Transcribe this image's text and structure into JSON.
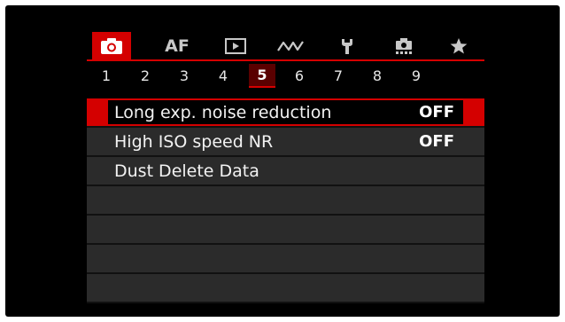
{
  "tabs": [
    {
      "id": "shooting",
      "icon": "camera-icon",
      "active": true
    },
    {
      "id": "af",
      "label": "AF",
      "active": false
    },
    {
      "id": "playback",
      "icon": "playback-icon",
      "active": false
    },
    {
      "id": "wireless",
      "icon": "wireless-icon",
      "active": false
    },
    {
      "id": "setup",
      "icon": "wrench-icon",
      "active": false
    },
    {
      "id": "custom",
      "icon": "custom-functions-icon",
      "active": false
    },
    {
      "id": "mymenu",
      "icon": "star-icon",
      "active": false
    }
  ],
  "pages": [
    "1",
    "2",
    "3",
    "4",
    "5",
    "6",
    "7",
    "8",
    "9"
  ],
  "active_page": "5",
  "items": [
    {
      "label": "Long exp. noise reduction",
      "value": "OFF",
      "selected": true
    },
    {
      "label": "High ISO speed NR",
      "value": "OFF",
      "selected": false
    },
    {
      "label": "Dust Delete Data",
      "value": "",
      "selected": false
    },
    {
      "label": "",
      "value": "",
      "selected": false
    },
    {
      "label": "",
      "value": "",
      "selected": false
    },
    {
      "label": "",
      "value": "",
      "selected": false
    },
    {
      "label": "",
      "value": "",
      "selected": false
    }
  ],
  "colors": {
    "accent": "#d40000",
    "active_page_bg": "#5a0000",
    "row_bg": "#2b2b2b",
    "screen_bg": "#000000"
  }
}
